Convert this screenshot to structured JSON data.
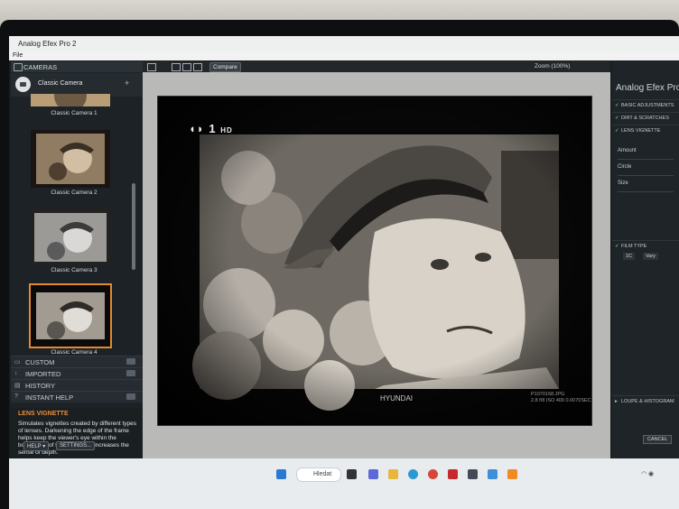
{
  "window": {
    "title": "Analog Efex Pro 2",
    "menu_file": "File"
  },
  "left_panel": {
    "header": "CAMERAS",
    "category": "Classic Camera",
    "cameras": [
      {
        "label": "Classic Camera 1"
      },
      {
        "label": "Classic Camera 2"
      },
      {
        "label": "Classic Camera 3"
      },
      {
        "label": "Classic Camera 4",
        "selected": true
      }
    ],
    "sections": [
      "CUSTOM",
      "IMPORTED",
      "HISTORY",
      "INSTANT HELP"
    ],
    "help_title": "LENS VIGNETTE",
    "help_text": "Simulates vignettes created by different types of lenses. Darkening the edge of the frame helps keep the viewer's eye within the boundaries of the image and increases the sense of depth.",
    "help_button": "HELP ▾",
    "settings_button": "SETTINGS..."
  },
  "toolbar": {
    "compare": "Compare",
    "zoom": "Zoom (100%)"
  },
  "photo": {
    "tv_logo": "1",
    "tv_logo_sub": "HD",
    "sponsor": "HYUNDAI",
    "filename": "P1070168.JPG",
    "exif": "2.8 f/8 ISO 400 0.0070SEC"
  },
  "right_panel": {
    "brand": "Analog Efex Pro 2",
    "sections": [
      "BASIC ADJUSTMENTS",
      "DIRT & SCRATCHES",
      "LENS VIGNETTE"
    ],
    "vignette_controls": [
      "Amount",
      "Circle",
      "Size"
    ],
    "film_type": "FILM TYPE",
    "film_chips": [
      "1C",
      "Vary"
    ],
    "loupe": "LOUPE & HISTOGRAM",
    "cancel": "CANCEL"
  },
  "taskbar": {
    "search_placeholder": "Hledat"
  }
}
